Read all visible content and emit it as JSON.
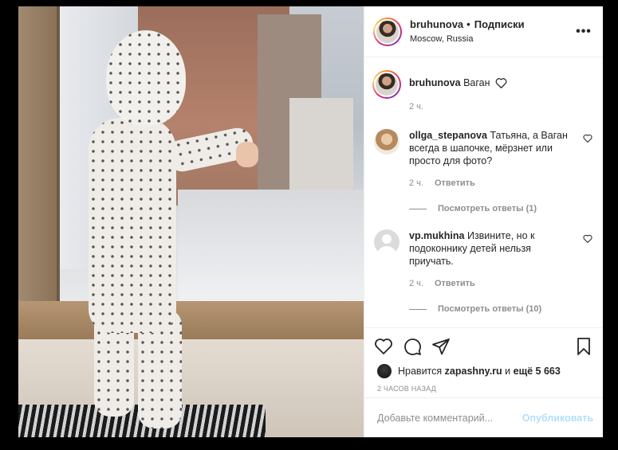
{
  "header": {
    "username": "bruhunova",
    "separator": "•",
    "follow_label": "Подписки",
    "location": "Moscow, Russia",
    "more_label": "•••"
  },
  "caption": {
    "username": "bruhunova",
    "text": "Ваган",
    "time": "2 ч."
  },
  "comments": [
    {
      "username": "ollga_stepanova",
      "text": "Татьяна, а Ваган всегда в шапочке, мёрзнет или просто для фото?",
      "time": "2 ч.",
      "reply_label": "Ответить",
      "view_replies": "Посмотреть ответы (1)"
    },
    {
      "username": "vp.mukhina",
      "text": "Извините, но к подоконнику детей нельзя приучать.",
      "time": "2 ч.",
      "reply_label": "Ответить",
      "view_replies": "Посмотреть ответы (10)"
    }
  ],
  "likes": {
    "prefix": "Нравится",
    "user": "zapashny.ru",
    "conj": "и",
    "others": "ещё 5 663"
  },
  "timestamp": "2 ЧАСОВ НАЗАД",
  "add_comment": {
    "placeholder": "Добавьте комментарий...",
    "publish_label": "Опубликовать"
  },
  "icons": {
    "like": "heart-icon",
    "comment": "comment-icon",
    "share": "share-icon",
    "save": "bookmark-icon",
    "more": "more-icon"
  },
  "colors": {
    "text": "#262626",
    "secondary": "#8e8e8e",
    "publish_disabled": "#b2dffc",
    "border": "#efefef"
  }
}
